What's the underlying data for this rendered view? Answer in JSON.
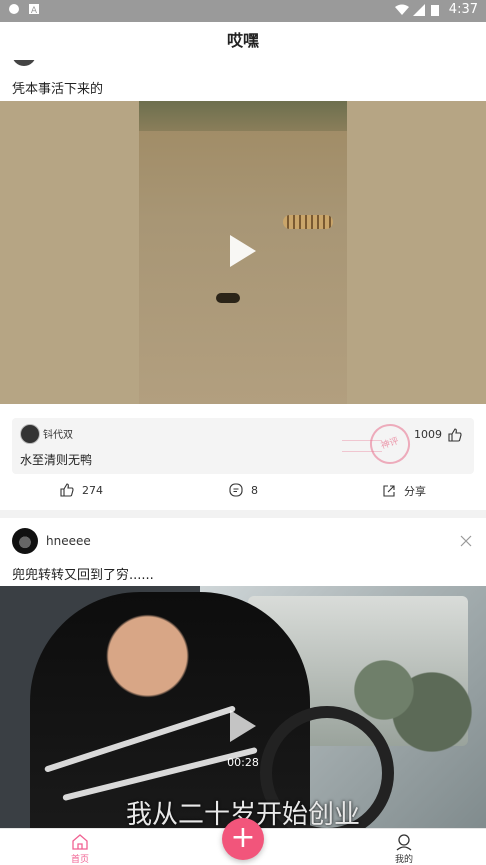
{
  "status_bar": {
    "time": "4:37",
    "left_icons": [
      "app-icon",
      "a-icon"
    ],
    "right_icons": [
      "wifi-icon",
      "signal-icon",
      "battery-icon"
    ]
  },
  "header": {
    "title": "哎嘿"
  },
  "posts": [
    {
      "text": "凭本事活下来的",
      "top_comment": {
        "user": "钭代双",
        "text": "水至清则无鸭",
        "likes": "1009",
        "stamp_text": "神评"
      },
      "actions": {
        "likes": "274",
        "comments": "8",
        "share_label": "分享"
      }
    },
    {
      "username": "hneeee",
      "text": "兜兜转转又回到了穷......",
      "video_duration": "00:28",
      "video_subtitle": "我从二十岁开始创业"
    }
  ],
  "tab_bar": {
    "home_label": "首页",
    "mine_label": "我的",
    "fab_label": "+"
  },
  "colors": {
    "accent": "#f2557b",
    "header_bg": "#ffffff",
    "status_bar": "#9a9a9a"
  }
}
